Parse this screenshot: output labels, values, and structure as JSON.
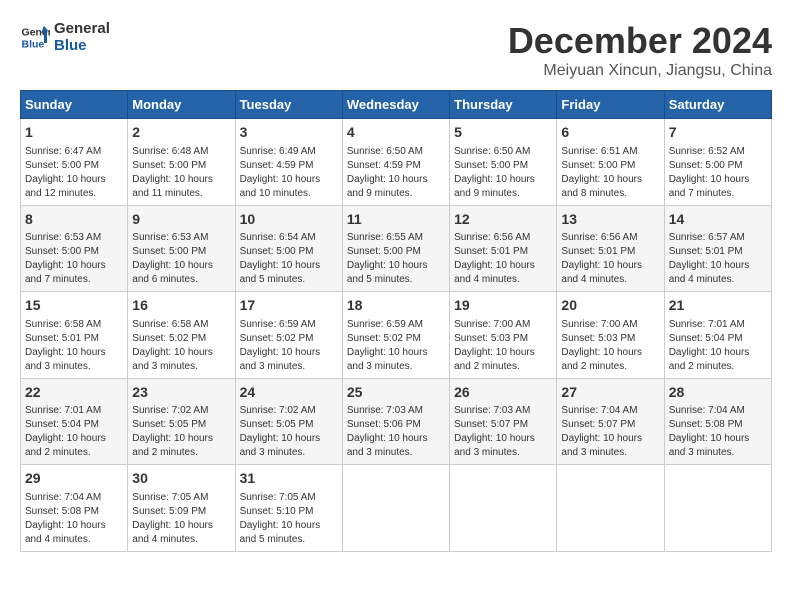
{
  "header": {
    "logo_line1": "General",
    "logo_line2": "Blue",
    "month": "December 2024",
    "location": "Meiyuan Xincun, Jiangsu, China"
  },
  "weekdays": [
    "Sunday",
    "Monday",
    "Tuesday",
    "Wednesday",
    "Thursday",
    "Friday",
    "Saturday"
  ],
  "weeks": [
    [
      {
        "day": "1",
        "detail": "Sunrise: 6:47 AM\nSunset: 5:00 PM\nDaylight: 10 hours and 12 minutes."
      },
      {
        "day": "2",
        "detail": "Sunrise: 6:48 AM\nSunset: 5:00 PM\nDaylight: 10 hours and 11 minutes."
      },
      {
        "day": "3",
        "detail": "Sunrise: 6:49 AM\nSunset: 4:59 PM\nDaylight: 10 hours and 10 minutes."
      },
      {
        "day": "4",
        "detail": "Sunrise: 6:50 AM\nSunset: 4:59 PM\nDaylight: 10 hours and 9 minutes."
      },
      {
        "day": "5",
        "detail": "Sunrise: 6:50 AM\nSunset: 5:00 PM\nDaylight: 10 hours and 9 minutes."
      },
      {
        "day": "6",
        "detail": "Sunrise: 6:51 AM\nSunset: 5:00 PM\nDaylight: 10 hours and 8 minutes."
      },
      {
        "day": "7",
        "detail": "Sunrise: 6:52 AM\nSunset: 5:00 PM\nDaylight: 10 hours and 7 minutes."
      }
    ],
    [
      {
        "day": "8",
        "detail": "Sunrise: 6:53 AM\nSunset: 5:00 PM\nDaylight: 10 hours and 7 minutes."
      },
      {
        "day": "9",
        "detail": "Sunrise: 6:53 AM\nSunset: 5:00 PM\nDaylight: 10 hours and 6 minutes."
      },
      {
        "day": "10",
        "detail": "Sunrise: 6:54 AM\nSunset: 5:00 PM\nDaylight: 10 hours and 5 minutes."
      },
      {
        "day": "11",
        "detail": "Sunrise: 6:55 AM\nSunset: 5:00 PM\nDaylight: 10 hours and 5 minutes."
      },
      {
        "day": "12",
        "detail": "Sunrise: 6:56 AM\nSunset: 5:01 PM\nDaylight: 10 hours and 4 minutes."
      },
      {
        "day": "13",
        "detail": "Sunrise: 6:56 AM\nSunset: 5:01 PM\nDaylight: 10 hours and 4 minutes."
      },
      {
        "day": "14",
        "detail": "Sunrise: 6:57 AM\nSunset: 5:01 PM\nDaylight: 10 hours and 4 minutes."
      }
    ],
    [
      {
        "day": "15",
        "detail": "Sunrise: 6:58 AM\nSunset: 5:01 PM\nDaylight: 10 hours and 3 minutes."
      },
      {
        "day": "16",
        "detail": "Sunrise: 6:58 AM\nSunset: 5:02 PM\nDaylight: 10 hours and 3 minutes."
      },
      {
        "day": "17",
        "detail": "Sunrise: 6:59 AM\nSunset: 5:02 PM\nDaylight: 10 hours and 3 minutes."
      },
      {
        "day": "18",
        "detail": "Sunrise: 6:59 AM\nSunset: 5:02 PM\nDaylight: 10 hours and 3 minutes."
      },
      {
        "day": "19",
        "detail": "Sunrise: 7:00 AM\nSunset: 5:03 PM\nDaylight: 10 hours and 2 minutes."
      },
      {
        "day": "20",
        "detail": "Sunrise: 7:00 AM\nSunset: 5:03 PM\nDaylight: 10 hours and 2 minutes."
      },
      {
        "day": "21",
        "detail": "Sunrise: 7:01 AM\nSunset: 5:04 PM\nDaylight: 10 hours and 2 minutes."
      }
    ],
    [
      {
        "day": "22",
        "detail": "Sunrise: 7:01 AM\nSunset: 5:04 PM\nDaylight: 10 hours and 2 minutes."
      },
      {
        "day": "23",
        "detail": "Sunrise: 7:02 AM\nSunset: 5:05 PM\nDaylight: 10 hours and 2 minutes."
      },
      {
        "day": "24",
        "detail": "Sunrise: 7:02 AM\nSunset: 5:05 PM\nDaylight: 10 hours and 3 minutes."
      },
      {
        "day": "25",
        "detail": "Sunrise: 7:03 AM\nSunset: 5:06 PM\nDaylight: 10 hours and 3 minutes."
      },
      {
        "day": "26",
        "detail": "Sunrise: 7:03 AM\nSunset: 5:07 PM\nDaylight: 10 hours and 3 minutes."
      },
      {
        "day": "27",
        "detail": "Sunrise: 7:04 AM\nSunset: 5:07 PM\nDaylight: 10 hours and 3 minutes."
      },
      {
        "day": "28",
        "detail": "Sunrise: 7:04 AM\nSunset: 5:08 PM\nDaylight: 10 hours and 3 minutes."
      }
    ],
    [
      {
        "day": "29",
        "detail": "Sunrise: 7:04 AM\nSunset: 5:08 PM\nDaylight: 10 hours and 4 minutes."
      },
      {
        "day": "30",
        "detail": "Sunrise: 7:05 AM\nSunset: 5:09 PM\nDaylight: 10 hours and 4 minutes."
      },
      {
        "day": "31",
        "detail": "Sunrise: 7:05 AM\nSunset: 5:10 PM\nDaylight: 10 hours and 5 minutes."
      },
      {
        "day": "",
        "detail": ""
      },
      {
        "day": "",
        "detail": ""
      },
      {
        "day": "",
        "detail": ""
      },
      {
        "day": "",
        "detail": ""
      }
    ]
  ]
}
